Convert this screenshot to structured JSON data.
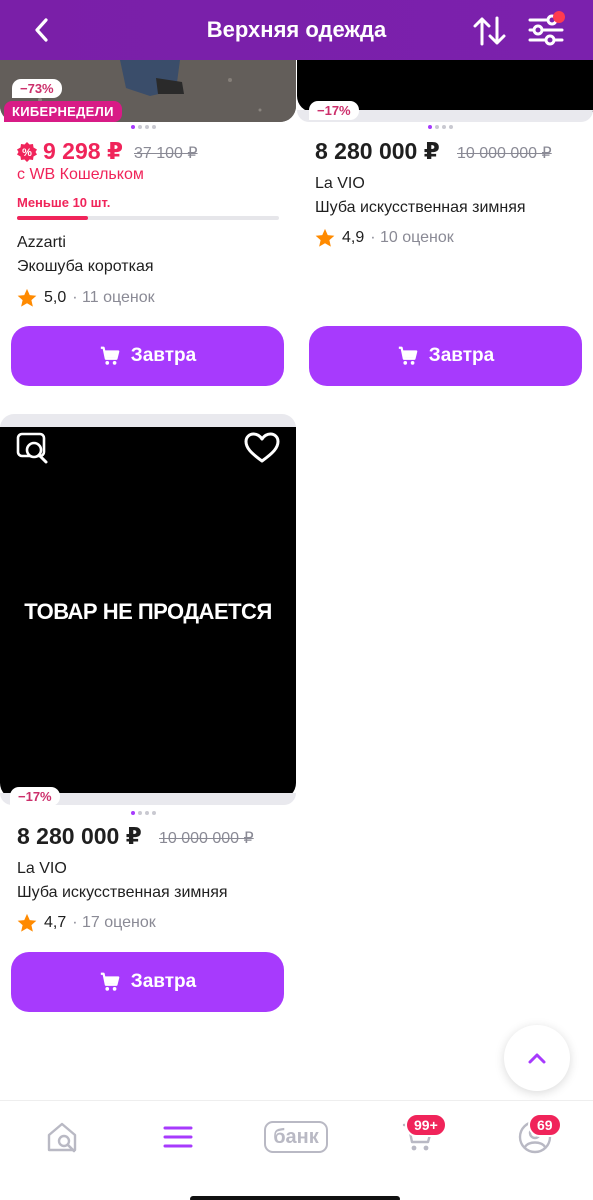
{
  "header": {
    "title": "Верхняя одежда",
    "back_icon": "chevron-left-icon",
    "sort_icon": "sort-arrows-icon",
    "filter_icon": "sliders-icon",
    "background": "#7b21ad"
  },
  "products": [
    {
      "discount": "−73%",
      "promo_tag": "КИБЕРНЕДЕЛИ",
      "price": "9 298 ₽",
      "old_price": "37 100 ₽",
      "wallet_text": "с WB Кошельком",
      "stock_text": "Меньше 10 шт.",
      "stock_fill": 0.27,
      "brand": "Azzarti",
      "name": "Экошуба короткая",
      "rating": "5,0",
      "reviews": "· 11 оценок",
      "buy_label": "Завтра"
    },
    {
      "discount": "−17%",
      "price": "8 280 000 ₽",
      "old_price": "10 000 000 ₽",
      "brand": "La VIO",
      "name": "Шуба искусственная зимняя",
      "rating": "4,9",
      "reviews": "· 10 оценок",
      "buy_label": "Завтра"
    },
    {
      "discount": "−17%",
      "image_text": "ТОВАР НЕ ПРОДАЕТСЯ",
      "price": "8 280 000 ₽",
      "old_price": "10 000 000 ₽",
      "brand": "La VIO",
      "name": "Шуба искусственная зимняя",
      "rating": "4,7",
      "reviews": "· 17 оценок",
      "buy_label": "Завтра"
    }
  ],
  "nav": {
    "home_icon": "home-search-icon",
    "catalog_icon": "menu-icon",
    "bank_label": "банк",
    "cart_badge": "99+",
    "profile_badge": "69"
  },
  "colors": {
    "accent": "#a73afd",
    "sale": "#f0245a",
    "header": "#7b21ad"
  }
}
